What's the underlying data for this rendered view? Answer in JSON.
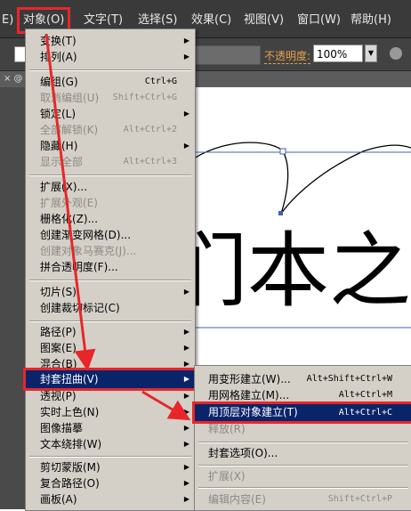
{
  "menubar": {
    "partial_left": "E)",
    "items": [
      {
        "label": "对象(O)",
        "active": true
      },
      {
        "label": "文字(T)"
      },
      {
        "label": "选择(S)"
      },
      {
        "label": "效果(C)"
      },
      {
        "label": "视图(V)"
      },
      {
        "label": "窗口(W)"
      },
      {
        "label": "帮助(H)"
      }
    ]
  },
  "toolbar": {
    "opacity_label": "不透明度:",
    "opacity_value": "100%"
  },
  "tabstrip": {
    "text": "× @"
  },
  "object_menu": {
    "items": [
      {
        "label": "变换(T)",
        "submenu": true
      },
      {
        "label": "排列(A)",
        "submenu": true
      },
      {
        "label": "编组(G)",
        "shortcut": "Ctrl+G"
      },
      {
        "label": "取消编组(U)",
        "shortcut": "Shift+Ctrl+G",
        "disabled": true
      },
      {
        "label": "锁定(L)",
        "submenu": true
      },
      {
        "label": "全部解锁(K)",
        "shortcut": "Alt+Ctrl+2",
        "disabled": true
      },
      {
        "label": "隐藏(H)",
        "submenu": true
      },
      {
        "label": "显示全部",
        "shortcut": "Alt+Ctrl+3",
        "disabled": true
      },
      {
        "label": "扩展(X)..."
      },
      {
        "label": "扩展外观(E)",
        "disabled": true
      },
      {
        "label": "栅格化(Z)..."
      },
      {
        "label": "创建渐变网格(D)..."
      },
      {
        "label": "创建对象马赛克(J)...",
        "disabled": true
      },
      {
        "label": "拼合透明度(F)..."
      },
      {
        "label": "切片(S)",
        "submenu": true
      },
      {
        "label": "创建裁切标记(C)"
      },
      {
        "label": "路径(P)",
        "submenu": true
      },
      {
        "label": "图案(E)",
        "submenu": true
      },
      {
        "label": "混合(B)",
        "submenu": true
      },
      {
        "label": "封套扭曲(V)",
        "submenu": true,
        "highlighted": true
      },
      {
        "label": "透视(P)",
        "submenu": true
      },
      {
        "label": "实时上色(N)",
        "submenu": true
      },
      {
        "label": "图像描摹",
        "submenu": true
      },
      {
        "label": "文本绕排(W)",
        "submenu": true
      },
      {
        "label": "剪切蒙版(M)",
        "submenu": true
      },
      {
        "label": "复合路径(O)",
        "submenu": true
      },
      {
        "label": "画板(A)",
        "submenu": true
      }
    ]
  },
  "envelope_submenu": {
    "items": [
      {
        "label": "用变形建立(W)...",
        "shortcut": "Alt+Shift+Ctrl+W"
      },
      {
        "label": "用网格建立(M)...",
        "shortcut": "Alt+Ctrl+M"
      },
      {
        "label": "用顶层对象建立(T)",
        "shortcut": "Alt+Ctrl+C",
        "highlighted": true
      },
      {
        "label": "释放(R)",
        "disabled": true
      },
      {
        "label": "封套选项(O)..."
      },
      {
        "label": "扩展(X)",
        "disabled": true
      },
      {
        "label": "编辑内容(E)",
        "shortcut": "Shift+Ctrl+P",
        "disabled": true
      }
    ]
  },
  "artwork": {
    "text": "们本之家"
  },
  "colors": {
    "menubar_bg": "#3a3a3a",
    "menu_bg": "#d4d0c8",
    "highlight_bg": "#0a246a",
    "annotation_red": "#e8262a",
    "opacity_label": "#e8a34a",
    "path_blue": "#3a62b8"
  }
}
